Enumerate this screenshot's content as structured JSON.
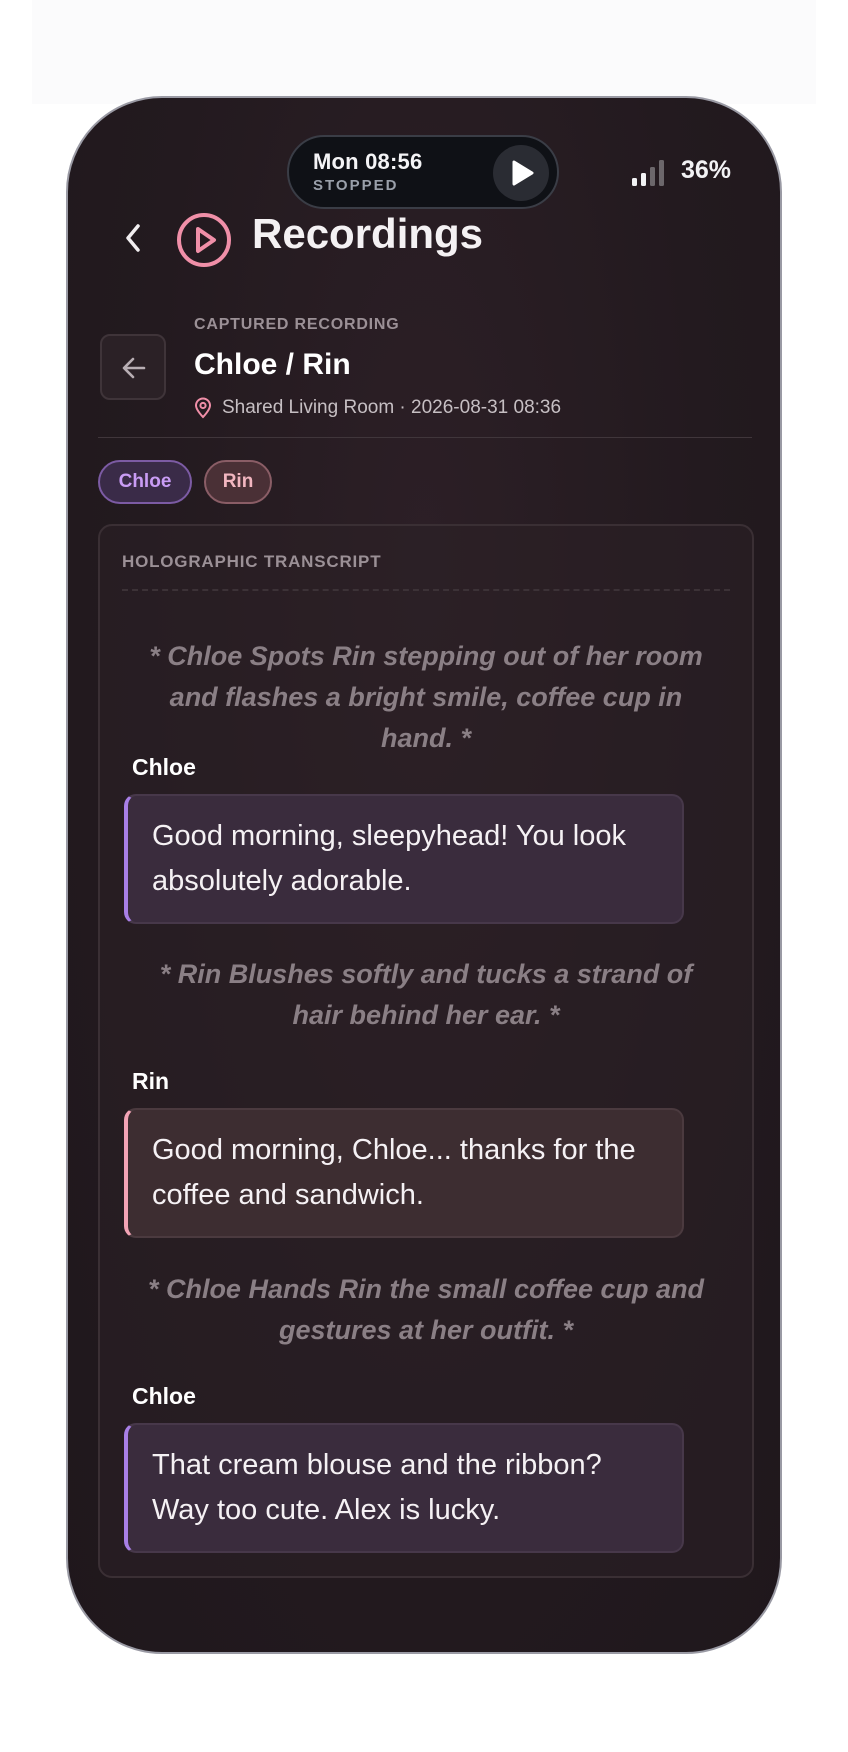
{
  "status_bar": {
    "time": "Mon 08:56",
    "playback_state": "STOPPED",
    "battery": "36%"
  },
  "header": {
    "title": "Recordings"
  },
  "recording": {
    "kicker": "CAPTURED RECORDING",
    "title": "Chloe / Rin",
    "meta": "Shared Living Room · 2026-08-31 08:36"
  },
  "participants": [
    {
      "label": "Chloe",
      "color": "#c99cf5"
    },
    {
      "label": "Rin",
      "color": "#f2b6c0"
    }
  ],
  "transcript": {
    "title": "HOLOGRAPHIC TRANSCRIPT",
    "entries": [
      {
        "type": "action",
        "text": "* Chloe Spots Rin stepping out of her room and flashes a bright smile, coffee cup in hand. *"
      },
      {
        "type": "line",
        "speaker": "Chloe",
        "text": "Good morning, sleepyhead! You look absolutely adorable."
      },
      {
        "type": "action",
        "text": "* Rin Blushes softly and tucks a strand of hair behind her ear. *"
      },
      {
        "type": "line",
        "speaker": "Rin",
        "text": "Good morning, Chloe... thanks for the coffee and sandwich."
      },
      {
        "type": "action",
        "text": "* Chloe Hands Rin the small coffee cup and gestures at her outfit. *"
      },
      {
        "type": "line",
        "speaker": "Chloe",
        "text": "That cream blouse and the ribbon? Way too cute. Alex is lucky."
      }
    ]
  },
  "colors": {
    "accent_pink": "#f08fa8",
    "chloe_accent": "#a87fe6",
    "rin_accent": "#f2a3b5"
  },
  "icons": {
    "back": "chevron-left-icon",
    "recordings": "play-circle-icon",
    "back_square": "arrow-left-icon",
    "location": "map-pin-icon",
    "play": "play-icon",
    "signal": "signal-icon"
  }
}
